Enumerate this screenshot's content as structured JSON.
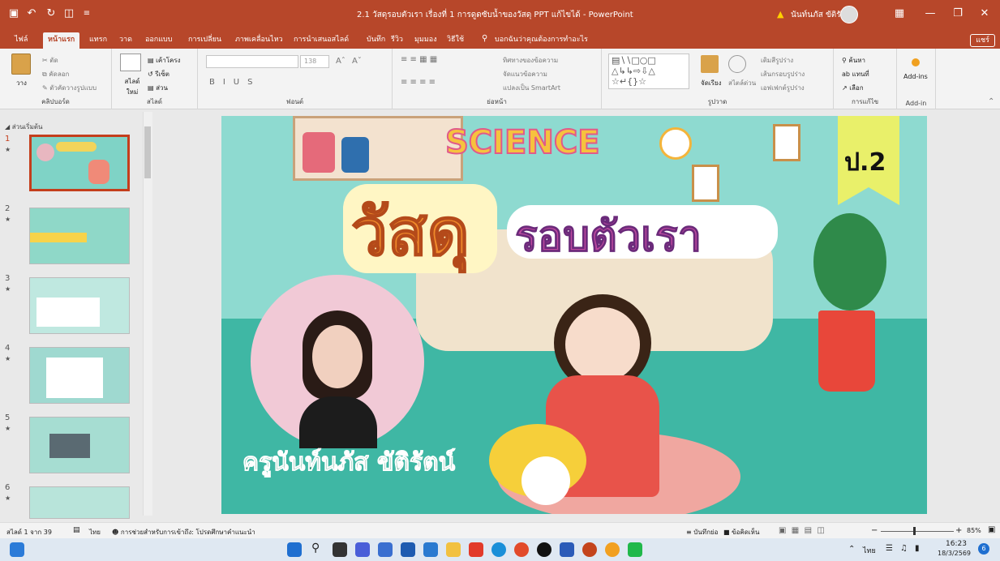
{
  "window": {
    "title": "2.1 วัสดุรอบตัวเรา เรื่องที่ 1 การดูดซับน้ำของวัสดุ PPT แก้ไขได้  -  PowerPoint",
    "user": "นันท์นภัส ขัติรัตน์"
  },
  "tabs": [
    "ไฟล์",
    "หน้าแรก",
    "แทรก",
    "วาด",
    "ออกแบบ",
    "การเปลี่ยน",
    "ภาพเคลื่อนไหว",
    "การนำเสนอสไลด์",
    "บันทึก",
    "รีวิว",
    "มุมมอง",
    "วิธีใช้"
  ],
  "active_tab": "หน้าแรก",
  "tell_me": "บอกฉันว่าคุณต้องการทำอะไร",
  "share_label": "แชร์",
  "ribbon": {
    "clipboard": {
      "paste": "วาง",
      "cut": "ตัด",
      "copy": "คัดลอก",
      "format_painter": "ตัวคัดวางรูปแบบ",
      "label": "คลิปบอร์ด"
    },
    "slides": {
      "new_slide": "สไลด์ใหม่",
      "layout": "เค้าโครง",
      "reset": "รีเซ็ต",
      "section": "ส่วน",
      "label": "สไลด์"
    },
    "font": {
      "size": "138",
      "label": "ฟอนต์"
    },
    "paragraph": {
      "text_direction": "ทิศทางของข้อความ",
      "align_text": "จัดแนวข้อความ",
      "smartart": "แปลงเป็น SmartArt",
      "label": "ย่อหน้า"
    },
    "drawing": {
      "arrange": "จัดเรียง",
      "quick_styles": "สไตล์ด่วน",
      "shape_fill": "เติมสีรูปร่าง",
      "shape_outline": "เส้นกรอบรูปร่าง",
      "shape_effects": "เอฟเฟกต์รูปร่าง",
      "label": "รูปวาด"
    },
    "editing": {
      "find": "ค้นหา",
      "replace": "แทนที่",
      "select": "เลือก",
      "label": "การแก้ไข"
    },
    "addins": {
      "button": "Add-ins",
      "label": "Add-in"
    }
  },
  "panel": {
    "section": "ส่วนเริ่มต้น",
    "slides": [
      "1",
      "2",
      "3",
      "4",
      "5",
      "6"
    ]
  },
  "slide": {
    "science": "SCIENCE",
    "grade": "ป.2",
    "title_main": "วัสดุ",
    "title_sub": "รอบตัวเรา",
    "teacher": "ครูนันท์นภัส ขัติรัตน์"
  },
  "status": {
    "slide_count": "สไลด์ 1 จาก 39",
    "language": "ไทย",
    "accessibility": "การช่วยสำหรับการเข้าถึง: โปรดศึกษาคำแนะนำ",
    "notes": "บันทึกย่อ",
    "comments": "ข้อคิดเห็น",
    "zoom": "85%"
  },
  "taskbar": {
    "lang": "ไทย",
    "time": "16:23",
    "date": "18/3/2569",
    "badge": "6"
  },
  "colors": {
    "accent": "#b7472a",
    "slide_bg": "#7fd3c6"
  }
}
